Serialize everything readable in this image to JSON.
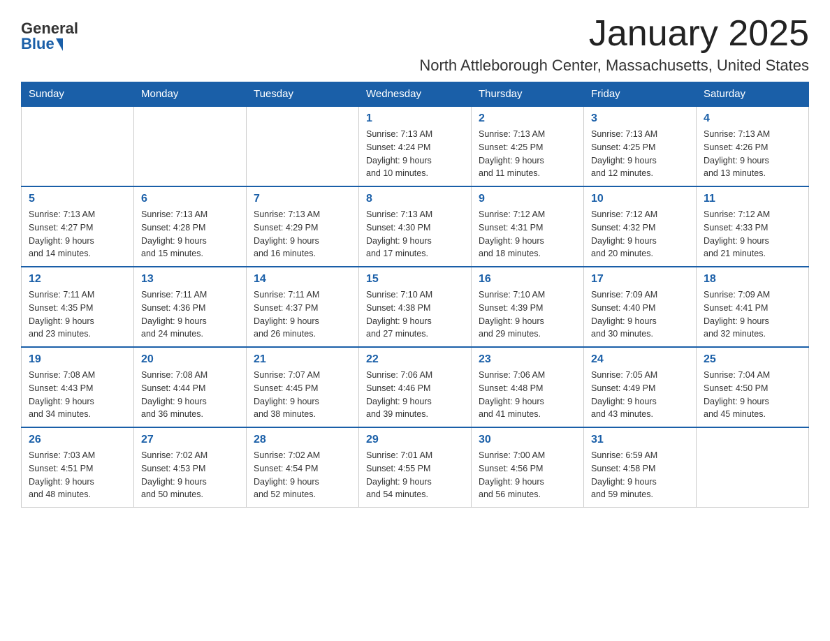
{
  "logo": {
    "general": "General",
    "blue": "Blue"
  },
  "title": "January 2025",
  "subtitle": "North Attleborough Center, Massachusetts, United States",
  "weekdays": [
    "Sunday",
    "Monday",
    "Tuesday",
    "Wednesday",
    "Thursday",
    "Friday",
    "Saturday"
  ],
  "weeks": [
    [
      {
        "day": "",
        "info": ""
      },
      {
        "day": "",
        "info": ""
      },
      {
        "day": "",
        "info": ""
      },
      {
        "day": "1",
        "info": "Sunrise: 7:13 AM\nSunset: 4:24 PM\nDaylight: 9 hours\nand 10 minutes."
      },
      {
        "day": "2",
        "info": "Sunrise: 7:13 AM\nSunset: 4:25 PM\nDaylight: 9 hours\nand 11 minutes."
      },
      {
        "day": "3",
        "info": "Sunrise: 7:13 AM\nSunset: 4:25 PM\nDaylight: 9 hours\nand 12 minutes."
      },
      {
        "day": "4",
        "info": "Sunrise: 7:13 AM\nSunset: 4:26 PM\nDaylight: 9 hours\nand 13 minutes."
      }
    ],
    [
      {
        "day": "5",
        "info": "Sunrise: 7:13 AM\nSunset: 4:27 PM\nDaylight: 9 hours\nand 14 minutes."
      },
      {
        "day": "6",
        "info": "Sunrise: 7:13 AM\nSunset: 4:28 PM\nDaylight: 9 hours\nand 15 minutes."
      },
      {
        "day": "7",
        "info": "Sunrise: 7:13 AM\nSunset: 4:29 PM\nDaylight: 9 hours\nand 16 minutes."
      },
      {
        "day": "8",
        "info": "Sunrise: 7:13 AM\nSunset: 4:30 PM\nDaylight: 9 hours\nand 17 minutes."
      },
      {
        "day": "9",
        "info": "Sunrise: 7:12 AM\nSunset: 4:31 PM\nDaylight: 9 hours\nand 18 minutes."
      },
      {
        "day": "10",
        "info": "Sunrise: 7:12 AM\nSunset: 4:32 PM\nDaylight: 9 hours\nand 20 minutes."
      },
      {
        "day": "11",
        "info": "Sunrise: 7:12 AM\nSunset: 4:33 PM\nDaylight: 9 hours\nand 21 minutes."
      }
    ],
    [
      {
        "day": "12",
        "info": "Sunrise: 7:11 AM\nSunset: 4:35 PM\nDaylight: 9 hours\nand 23 minutes."
      },
      {
        "day": "13",
        "info": "Sunrise: 7:11 AM\nSunset: 4:36 PM\nDaylight: 9 hours\nand 24 minutes."
      },
      {
        "day": "14",
        "info": "Sunrise: 7:11 AM\nSunset: 4:37 PM\nDaylight: 9 hours\nand 26 minutes."
      },
      {
        "day": "15",
        "info": "Sunrise: 7:10 AM\nSunset: 4:38 PM\nDaylight: 9 hours\nand 27 minutes."
      },
      {
        "day": "16",
        "info": "Sunrise: 7:10 AM\nSunset: 4:39 PM\nDaylight: 9 hours\nand 29 minutes."
      },
      {
        "day": "17",
        "info": "Sunrise: 7:09 AM\nSunset: 4:40 PM\nDaylight: 9 hours\nand 30 minutes."
      },
      {
        "day": "18",
        "info": "Sunrise: 7:09 AM\nSunset: 4:41 PM\nDaylight: 9 hours\nand 32 minutes."
      }
    ],
    [
      {
        "day": "19",
        "info": "Sunrise: 7:08 AM\nSunset: 4:43 PM\nDaylight: 9 hours\nand 34 minutes."
      },
      {
        "day": "20",
        "info": "Sunrise: 7:08 AM\nSunset: 4:44 PM\nDaylight: 9 hours\nand 36 minutes."
      },
      {
        "day": "21",
        "info": "Sunrise: 7:07 AM\nSunset: 4:45 PM\nDaylight: 9 hours\nand 38 minutes."
      },
      {
        "day": "22",
        "info": "Sunrise: 7:06 AM\nSunset: 4:46 PM\nDaylight: 9 hours\nand 39 minutes."
      },
      {
        "day": "23",
        "info": "Sunrise: 7:06 AM\nSunset: 4:48 PM\nDaylight: 9 hours\nand 41 minutes."
      },
      {
        "day": "24",
        "info": "Sunrise: 7:05 AM\nSunset: 4:49 PM\nDaylight: 9 hours\nand 43 minutes."
      },
      {
        "day": "25",
        "info": "Sunrise: 7:04 AM\nSunset: 4:50 PM\nDaylight: 9 hours\nand 45 minutes."
      }
    ],
    [
      {
        "day": "26",
        "info": "Sunrise: 7:03 AM\nSunset: 4:51 PM\nDaylight: 9 hours\nand 48 minutes."
      },
      {
        "day": "27",
        "info": "Sunrise: 7:02 AM\nSunset: 4:53 PM\nDaylight: 9 hours\nand 50 minutes."
      },
      {
        "day": "28",
        "info": "Sunrise: 7:02 AM\nSunset: 4:54 PM\nDaylight: 9 hours\nand 52 minutes."
      },
      {
        "day": "29",
        "info": "Sunrise: 7:01 AM\nSunset: 4:55 PM\nDaylight: 9 hours\nand 54 minutes."
      },
      {
        "day": "30",
        "info": "Sunrise: 7:00 AM\nSunset: 4:56 PM\nDaylight: 9 hours\nand 56 minutes."
      },
      {
        "day": "31",
        "info": "Sunrise: 6:59 AM\nSunset: 4:58 PM\nDaylight: 9 hours\nand 59 minutes."
      },
      {
        "day": "",
        "info": ""
      }
    ]
  ]
}
